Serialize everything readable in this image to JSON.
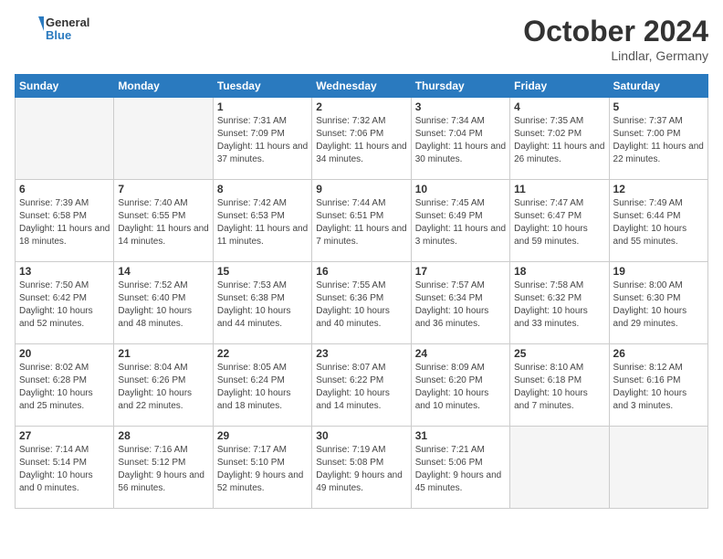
{
  "header": {
    "logo_line1": "General",
    "logo_line2": "Blue",
    "month_title": "October 2024",
    "location": "Lindlar, Germany"
  },
  "weekdays": [
    "Sunday",
    "Monday",
    "Tuesday",
    "Wednesday",
    "Thursday",
    "Friday",
    "Saturday"
  ],
  "weeks": [
    [
      {
        "day": "",
        "info": ""
      },
      {
        "day": "",
        "info": ""
      },
      {
        "day": "1",
        "info": "Sunrise: 7:31 AM\nSunset: 7:09 PM\nDaylight: 11 hours and 37 minutes."
      },
      {
        "day": "2",
        "info": "Sunrise: 7:32 AM\nSunset: 7:06 PM\nDaylight: 11 hours and 34 minutes."
      },
      {
        "day": "3",
        "info": "Sunrise: 7:34 AM\nSunset: 7:04 PM\nDaylight: 11 hours and 30 minutes."
      },
      {
        "day": "4",
        "info": "Sunrise: 7:35 AM\nSunset: 7:02 PM\nDaylight: 11 hours and 26 minutes."
      },
      {
        "day": "5",
        "info": "Sunrise: 7:37 AM\nSunset: 7:00 PM\nDaylight: 11 hours and 22 minutes."
      }
    ],
    [
      {
        "day": "6",
        "info": "Sunrise: 7:39 AM\nSunset: 6:58 PM\nDaylight: 11 hours and 18 minutes."
      },
      {
        "day": "7",
        "info": "Sunrise: 7:40 AM\nSunset: 6:55 PM\nDaylight: 11 hours and 14 minutes."
      },
      {
        "day": "8",
        "info": "Sunrise: 7:42 AM\nSunset: 6:53 PM\nDaylight: 11 hours and 11 minutes."
      },
      {
        "day": "9",
        "info": "Sunrise: 7:44 AM\nSunset: 6:51 PM\nDaylight: 11 hours and 7 minutes."
      },
      {
        "day": "10",
        "info": "Sunrise: 7:45 AM\nSunset: 6:49 PM\nDaylight: 11 hours and 3 minutes."
      },
      {
        "day": "11",
        "info": "Sunrise: 7:47 AM\nSunset: 6:47 PM\nDaylight: 10 hours and 59 minutes."
      },
      {
        "day": "12",
        "info": "Sunrise: 7:49 AM\nSunset: 6:44 PM\nDaylight: 10 hours and 55 minutes."
      }
    ],
    [
      {
        "day": "13",
        "info": "Sunrise: 7:50 AM\nSunset: 6:42 PM\nDaylight: 10 hours and 52 minutes."
      },
      {
        "day": "14",
        "info": "Sunrise: 7:52 AM\nSunset: 6:40 PM\nDaylight: 10 hours and 48 minutes."
      },
      {
        "day": "15",
        "info": "Sunrise: 7:53 AM\nSunset: 6:38 PM\nDaylight: 10 hours and 44 minutes."
      },
      {
        "day": "16",
        "info": "Sunrise: 7:55 AM\nSunset: 6:36 PM\nDaylight: 10 hours and 40 minutes."
      },
      {
        "day": "17",
        "info": "Sunrise: 7:57 AM\nSunset: 6:34 PM\nDaylight: 10 hours and 36 minutes."
      },
      {
        "day": "18",
        "info": "Sunrise: 7:58 AM\nSunset: 6:32 PM\nDaylight: 10 hours and 33 minutes."
      },
      {
        "day": "19",
        "info": "Sunrise: 8:00 AM\nSunset: 6:30 PM\nDaylight: 10 hours and 29 minutes."
      }
    ],
    [
      {
        "day": "20",
        "info": "Sunrise: 8:02 AM\nSunset: 6:28 PM\nDaylight: 10 hours and 25 minutes."
      },
      {
        "day": "21",
        "info": "Sunrise: 8:04 AM\nSunset: 6:26 PM\nDaylight: 10 hours and 22 minutes."
      },
      {
        "day": "22",
        "info": "Sunrise: 8:05 AM\nSunset: 6:24 PM\nDaylight: 10 hours and 18 minutes."
      },
      {
        "day": "23",
        "info": "Sunrise: 8:07 AM\nSunset: 6:22 PM\nDaylight: 10 hours and 14 minutes."
      },
      {
        "day": "24",
        "info": "Sunrise: 8:09 AM\nSunset: 6:20 PM\nDaylight: 10 hours and 10 minutes."
      },
      {
        "day": "25",
        "info": "Sunrise: 8:10 AM\nSunset: 6:18 PM\nDaylight: 10 hours and 7 minutes."
      },
      {
        "day": "26",
        "info": "Sunrise: 8:12 AM\nSunset: 6:16 PM\nDaylight: 10 hours and 3 minutes."
      }
    ],
    [
      {
        "day": "27",
        "info": "Sunrise: 7:14 AM\nSunset: 5:14 PM\nDaylight: 10 hours and 0 minutes."
      },
      {
        "day": "28",
        "info": "Sunrise: 7:16 AM\nSunset: 5:12 PM\nDaylight: 9 hours and 56 minutes."
      },
      {
        "day": "29",
        "info": "Sunrise: 7:17 AM\nSunset: 5:10 PM\nDaylight: 9 hours and 52 minutes."
      },
      {
        "day": "30",
        "info": "Sunrise: 7:19 AM\nSunset: 5:08 PM\nDaylight: 9 hours and 49 minutes."
      },
      {
        "day": "31",
        "info": "Sunrise: 7:21 AM\nSunset: 5:06 PM\nDaylight: 9 hours and 45 minutes."
      },
      {
        "day": "",
        "info": ""
      },
      {
        "day": "",
        "info": ""
      }
    ]
  ]
}
